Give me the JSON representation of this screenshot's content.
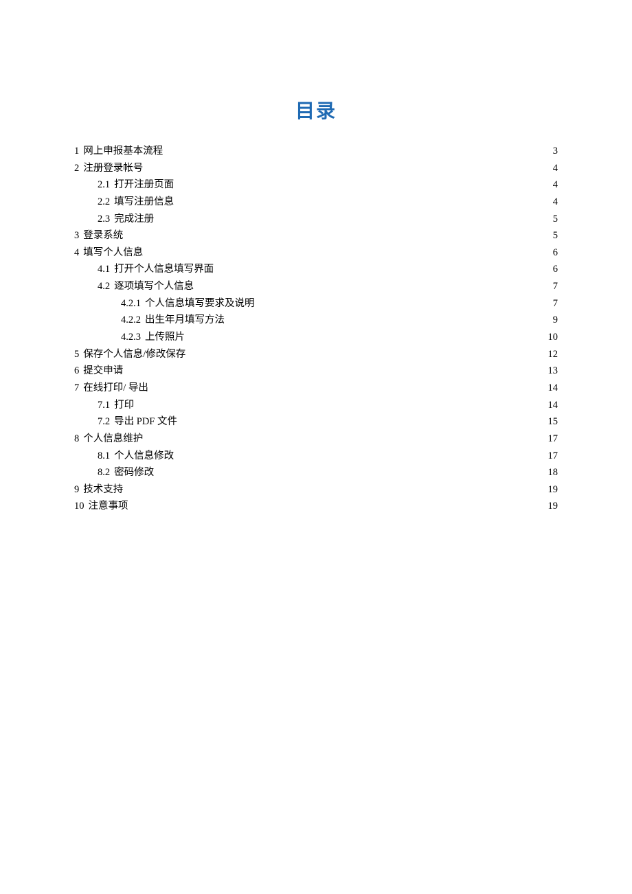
{
  "title": "目录",
  "entries": [
    {
      "level": 1,
      "num": "1",
      "label": "网上申报基本流程",
      "page": "3"
    },
    {
      "level": 1,
      "num": "2",
      "label": "注册登录帐号",
      "page": "4"
    },
    {
      "level": 2,
      "num": "2.1",
      "label": "打开注册页面",
      "page": "4"
    },
    {
      "level": 2,
      "num": "2.2",
      "label": "填写注册信息",
      "page": "4"
    },
    {
      "level": 2,
      "num": "2.3",
      "label": "完成注册",
      "page": "5"
    },
    {
      "level": 1,
      "num": "3",
      "label": "登录系统",
      "page": "5"
    },
    {
      "level": 1,
      "num": "4",
      "label": "填写个人信息",
      "page": "6"
    },
    {
      "level": 2,
      "num": "4.1",
      "label": "打开个人信息填写界面",
      "page": "6"
    },
    {
      "level": 2,
      "num": "4.2",
      "label": "逐项填写个人信息",
      "page": "7"
    },
    {
      "level": 3,
      "num": "4.2.1",
      "label": "个人信息填写要求及说明",
      "page": "7"
    },
    {
      "level": 3,
      "num": "4.2.2",
      "label": "出生年月填写方法",
      "page": "9"
    },
    {
      "level": 3,
      "num": "4.2.3",
      "label": "上传照片",
      "page": "10"
    },
    {
      "level": 1,
      "num": "5",
      "label": "保存个人信息/修改保存",
      "page": "12"
    },
    {
      "level": 1,
      "num": "6",
      "label": "提交申请",
      "page": "13"
    },
    {
      "level": 1,
      "num": "7",
      "label": "在线打印/ 导出",
      "page": "14"
    },
    {
      "level": 2,
      "num": "7.1",
      "label": "打印",
      "page": "14"
    },
    {
      "level": 2,
      "num": "7.2",
      "label": "导出 PDF 文件",
      "page": "15"
    },
    {
      "level": 1,
      "num": "8",
      "label": "个人信息维护",
      "page": "17"
    },
    {
      "level": 2,
      "num": "8.1",
      "label": "个人信息修改",
      "page": "17"
    },
    {
      "level": 2,
      "num": "8.2",
      "label": "密码修改",
      "page": "18"
    },
    {
      "level": 1,
      "num": "9",
      "label": "技术支持",
      "page": "19"
    },
    {
      "level": 1,
      "num": "10",
      "label": "注意事项",
      "page": "19"
    }
  ]
}
